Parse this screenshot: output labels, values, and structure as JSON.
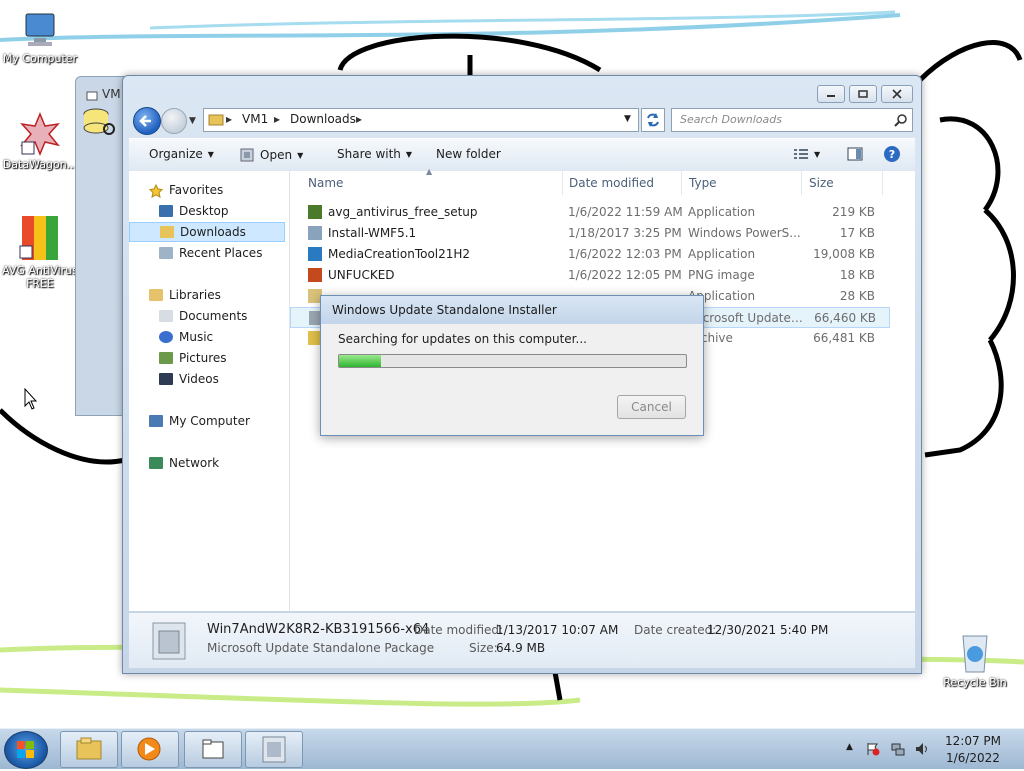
{
  "desktop": {
    "icons": [
      {
        "label": "My Computer",
        "icon": "computer-icon"
      },
      {
        "label": "DataWagon...",
        "icon": "datawagon-icon"
      },
      {
        "label": "AVG AntiVirus FREE",
        "icon": "avg-icon"
      },
      {
        "label": "Recycle Bin",
        "icon": "recycle-bin-icon"
      }
    ]
  },
  "background_window": {
    "title": "VM"
  },
  "explorer": {
    "breadcrumb": [
      "VM1",
      "Downloads"
    ],
    "search_placeholder": "Search Downloads",
    "toolbar": {
      "organize": "Organize",
      "open": "Open",
      "share_with": "Share with",
      "new_folder": "New folder"
    },
    "nav": {
      "favorites": "Favorites",
      "desktop": "Desktop",
      "downloads": "Downloads",
      "recent_places": "Recent Places",
      "libraries": "Libraries",
      "documents": "Documents",
      "music": "Music",
      "pictures": "Pictures",
      "videos": "Videos",
      "my_computer": "My Computer",
      "network": "Network"
    },
    "columns": {
      "name": "Name",
      "date": "Date modified",
      "type": "Type",
      "size": "Size"
    },
    "files": [
      {
        "name": "avg_antivirus_free_setup",
        "date": "1/6/2022 11:59 AM",
        "type": "Application",
        "size": "219 KB",
        "icon_color": "#4a7a2a"
      },
      {
        "name": "Install-WMF5.1",
        "date": "1/18/2017 3:25 PM",
        "type": "Windows PowerS...",
        "size": "17 KB",
        "icon_color": "#8aa3bd"
      },
      {
        "name": "MediaCreationTool21H2",
        "date": "1/6/2022 12:03 PM",
        "type": "Application",
        "size": "19,008 KB",
        "icon_color": "#2a7ac2"
      },
      {
        "name": "UNFUCKED",
        "date": "1/6/2022 12:05 PM",
        "type": "PNG image",
        "size": "18 KB",
        "icon_color": "#c44a1e"
      },
      {
        "name": "",
        "date": "",
        "type": "Application",
        "size": "28 KB",
        "icon_color": "#d9c27a"
      },
      {
        "name": "",
        "date": "",
        "type": "Microsoft Update ...",
        "size": "66,460 KB",
        "icon_color": "#9aa7b3"
      },
      {
        "name": "",
        "date": "",
        "type": "Archive",
        "size": "66,481 KB",
        "icon_color": "#e0c04a"
      }
    ],
    "details": {
      "filename": "Win7AndW2K8R2-KB3191566-x64",
      "kind": "Microsoft Update Standalone Package",
      "date_modified_label": "Date modified:",
      "date_modified": "1/13/2017 10:07 AM",
      "date_created_label": "Date created:",
      "date_created": "12/30/2021 5:40 PM",
      "size_label": "Size:",
      "size": "64.9 MB"
    }
  },
  "dialog": {
    "title": "Windows Update Standalone Installer",
    "message": "Searching for updates on this computer...",
    "progress": 0.12,
    "cancel": "Cancel"
  },
  "taskbar": {
    "time": "12:07 PM",
    "date": "1/6/2022"
  }
}
